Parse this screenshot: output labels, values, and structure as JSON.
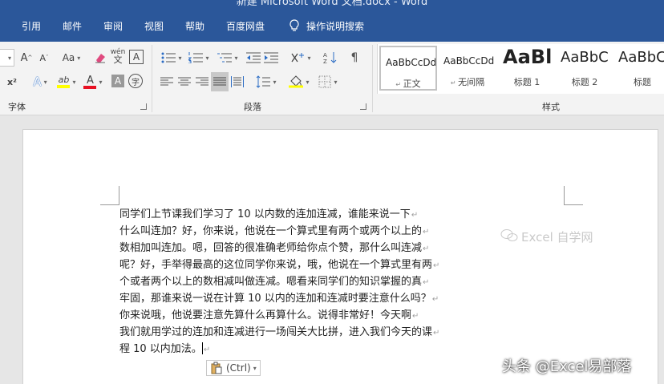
{
  "window": {
    "title": "新建 Microsoft Word 文档.docx - Word"
  },
  "tabs": [
    {
      "label": "引用"
    },
    {
      "label": "邮件"
    },
    {
      "label": "审阅"
    },
    {
      "label": "视图"
    },
    {
      "label": "帮助"
    },
    {
      "label": "百度网盘"
    },
    {
      "label": "操作说明搜索"
    }
  ],
  "ribbon": {
    "font_group_label": "字体",
    "paragraph_group_label": "段落",
    "styles_group_label": "样式",
    "font_buttons": {
      "grow": "A",
      "shrink": "A",
      "change_case": "Aa",
      "phonetic": "wén",
      "superscript": "x²",
      "font_color": "A",
      "highlight": "ab",
      "char_shading": "A",
      "enclose": "字"
    },
    "styles": [
      {
        "preview": "AaBbCcDd",
        "name": "正文",
        "selected": true
      },
      {
        "preview": "AaBbCcDd",
        "name": "无间隔"
      },
      {
        "preview": "AaBl",
        "name": "标题 1"
      },
      {
        "preview": "AaBbC",
        "name": "标题 2"
      },
      {
        "preview": "AaBbC",
        "name": "标题"
      }
    ]
  },
  "document": {
    "lines": [
      "同学们上节课我们学习了 10 以内数的连加连减，谁能来说一下",
      "什么叫连加？好，你来说，他说在一个算式里有两个或两个以上的",
      "数相加叫连加。嗯，回答的很准确老师给你点个赞，那什么叫连减",
      "呢？好，手举得最高的这位同学你来说，哦，他说在一个算式里有两",
      "个或者两个以上的数相减叫做连减。嗯看来同学们的知识掌握的真",
      "牢固，那谁来说一说在计算 10 以内的连加和连减时要注意什么吗？",
      "你来说哦，他说要注意先算什么再算什么。说得非常好！今天啊",
      "我们就用学过的连加和连减进行一场闯关大比拼，进入我们今天的课",
      "程 10 以内加法。"
    ],
    "paragraph_mark": "↵",
    "paste_options_label": "(Ctrl)"
  },
  "watermarks": {
    "channel": "Excel 自学网",
    "signature": "头条 @Excel易部落"
  },
  "colors": {
    "accent": "#2b579a",
    "font_color_bar": "#e81123",
    "highlight_bar": "#ffff00"
  }
}
